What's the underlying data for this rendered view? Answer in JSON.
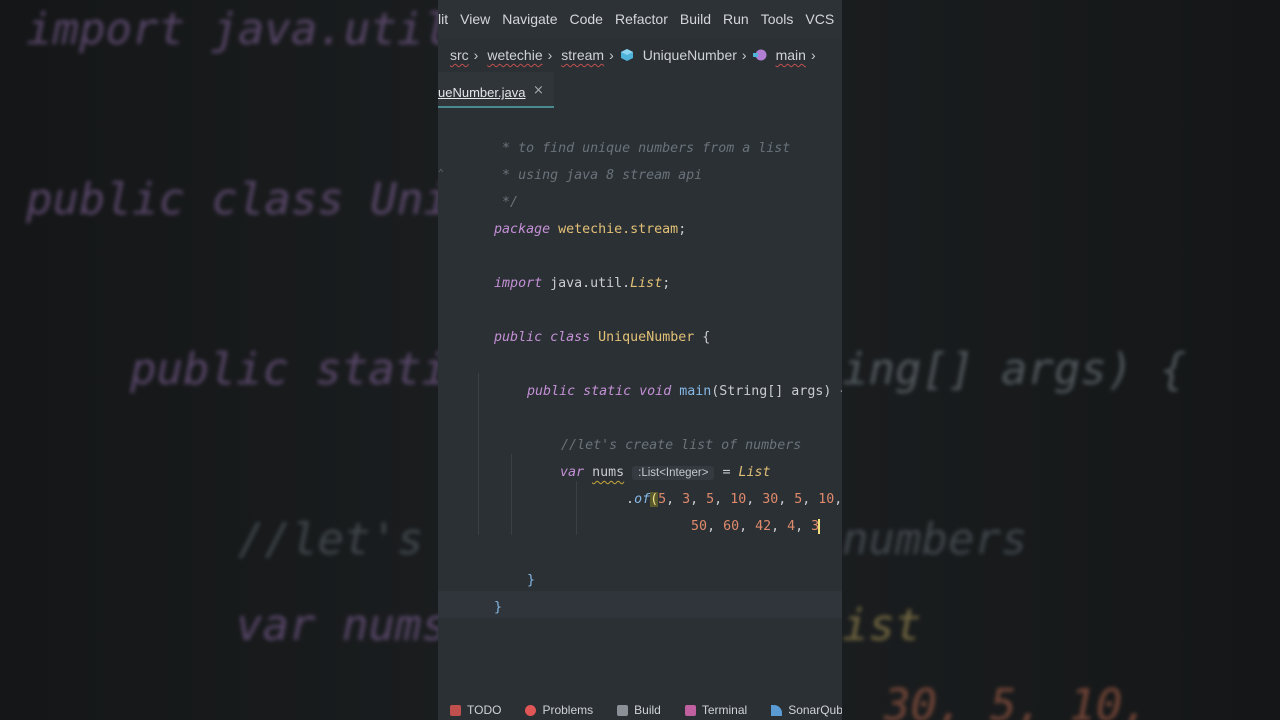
{
  "backdrop": {
    "lines": [
      {
        "text": "import java.util",
        "cls": "bg-kw"
      },
      {
        "text": "public class Uni",
        "cls": "bg-kw"
      },
      {
        "text": "public stati",
        "cls": "bg-kw"
      },
      {
        "text": "ing[] args) {",
        "cls": "bg-gr"
      },
      {
        "text": "//let's",
        "cls": "bg-cm"
      },
      {
        "text": "numbers",
        "cls": "bg-cm"
      },
      {
        "text": "var nums",
        "cls": "bg-kw"
      },
      {
        "text": "ist",
        "cls": "bg-yl"
      },
      {
        "text": "30, 5, 10,",
        "cls": "bg-or"
      }
    ]
  },
  "menubar": {
    "items": [
      "lit",
      "View",
      "Navigate",
      "Code",
      "Refactor",
      "Build",
      "Run",
      "Tools",
      "VCS"
    ]
  },
  "breadcrumbs": {
    "items": [
      "src",
      "wetechie",
      "stream",
      "UniqueNumber",
      "main"
    ]
  },
  "tab": {
    "label": "ueNumber.java",
    "close": "×"
  },
  "code": {
    "comment1": " * to find unique numbers from a list",
    "comment2": " * using java 8 stream api",
    "comment3": " */",
    "pkg_kw": "package",
    "pkg_name": "wetechie.stream",
    "pkg_semi": ";",
    "imp_kw": "import",
    "imp_path": "java.util.",
    "imp_cls": "List",
    "imp_semi": ";",
    "cls_kw1": "public",
    "cls_kw2": "class",
    "cls_name": "UniqueNumber",
    "cls_brace": "{",
    "m_kw1": "public",
    "m_kw2": "static",
    "m_kw3": "void",
    "m_name": "main",
    "m_params": "(String[] args) {",
    "line_comment": "//let's create list of numbers",
    "var_kw": "var",
    "var_name": "nums",
    "type_hint": ":List<Integer>",
    "assign": "= ",
    "list_cls": "List",
    "of_dot": ".",
    "of_fn": "of",
    "paren": "(",
    "row1_nums": [
      "5",
      "3",
      "5",
      "10",
      "30",
      "5",
      "10"
    ],
    "row2_nums": [
      "50",
      "60",
      "42",
      "4",
      "3"
    ],
    "inner_close": "}",
    "outer_close": "}"
  },
  "statusbar": {
    "items": [
      {
        "label": "TODO",
        "color": "#c0504d"
      },
      {
        "label": "Problems",
        "color": "#e05555"
      },
      {
        "label": "Build",
        "color": "#8a9096"
      },
      {
        "label": "Terminal",
        "color": "#c060a0"
      },
      {
        "label": "SonarQube",
        "color": "#5a9bd4"
      }
    ]
  }
}
